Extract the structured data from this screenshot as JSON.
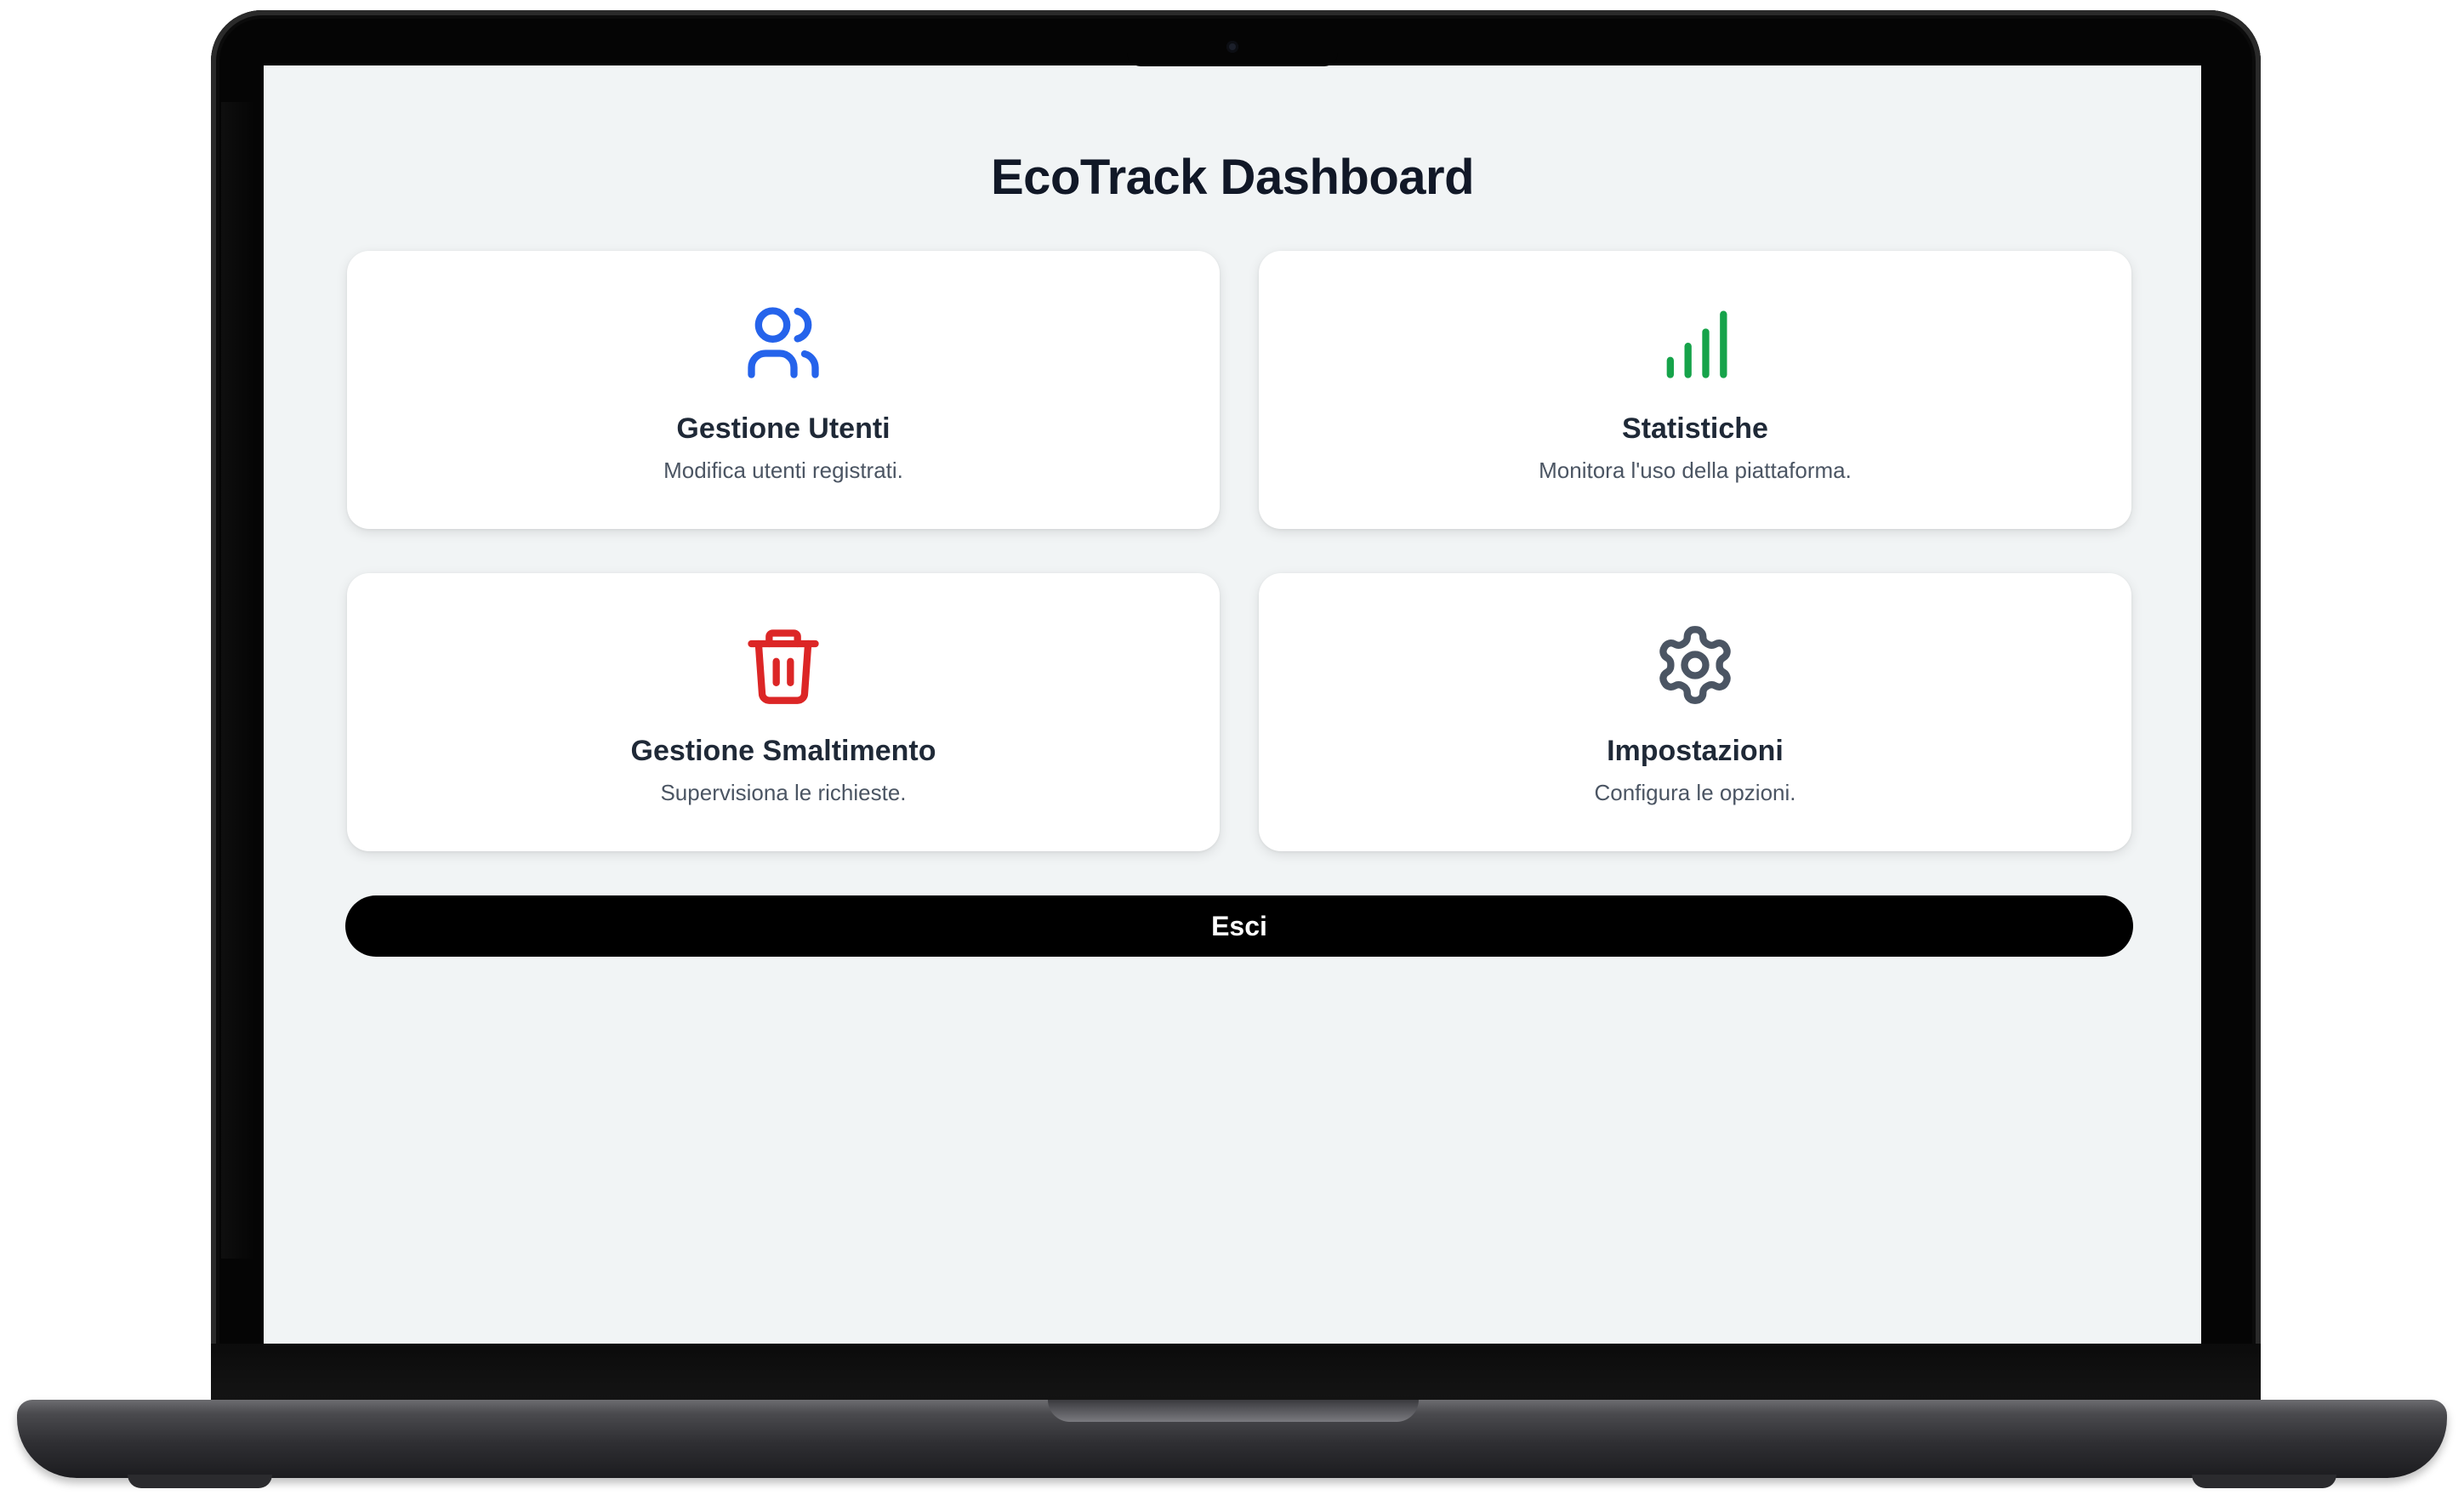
{
  "dashboard": {
    "title": "EcoTrack Dashboard",
    "cards": [
      {
        "title": "Gestione Utenti",
        "description": "Modifica utenti registrati.",
        "icon": "users-icon",
        "icon_color": "#2563eb"
      },
      {
        "title": "Statistiche",
        "description": "Monitora l'uso della piattaforma.",
        "icon": "signal-bars-icon",
        "icon_color": "#16a34a"
      },
      {
        "title": "Gestione Smaltimento",
        "description": "Supervisiona le richieste.",
        "icon": "trash-icon",
        "icon_color": "#dc2626"
      },
      {
        "title": "Impostazioni",
        "description": "Configura le opzioni.",
        "icon": "gear-icon",
        "icon_color": "#4b5563"
      }
    ],
    "logout_label": "Esci"
  },
  "colors": {
    "page_background": "#f1f4f5",
    "card_background": "#ffffff",
    "title_text": "#111827",
    "button_background": "#000000",
    "button_text": "#ffffff"
  }
}
